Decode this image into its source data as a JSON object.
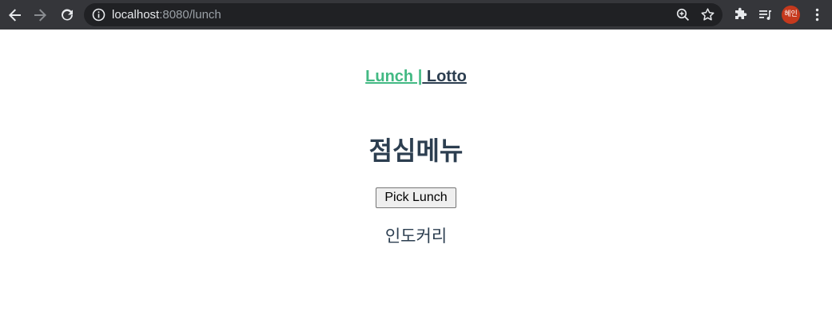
{
  "browser": {
    "url_host": "localhost",
    "url_rest": ":8080/lunch",
    "profile_initials": "혜인",
    "colors": {
      "chrome": "#35363a",
      "omnibox": "#202124",
      "avatar": "#c5391d"
    }
  },
  "nav": {
    "lunch_label": "Lunch |",
    "lotto_label": " Lotto",
    "colors": {
      "active": "#42b983",
      "inactive": "#2c3e50"
    }
  },
  "main": {
    "title": "점심메뉴",
    "pick_button_label": "Pick Lunch",
    "result": "인도커리"
  }
}
